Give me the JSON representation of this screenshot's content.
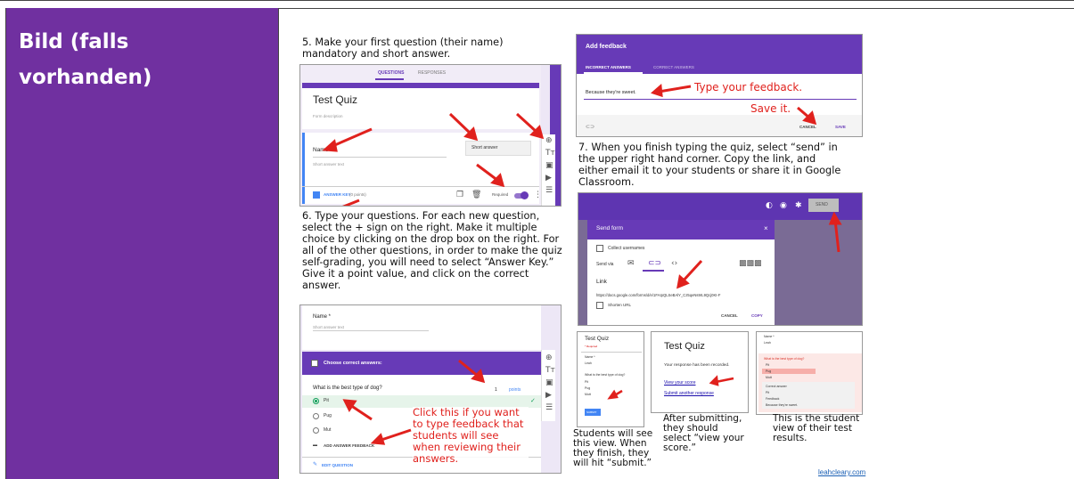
{
  "label": "Bild (falls vorhanden)",
  "captions": {
    "step5": "5. Make your first question (their name) mandatory and short answer.",
    "step6": "6. Type your questions. For each new question, select the + sign on the right. Make it multiple choice by clicking on the drop box on the right. For all of the other questions, in order to make the quiz self-grading, you will need to select “Answer Key.” Give it a point value, and click on the correct answer.",
    "step7": "7. When you finish typing the quiz, select “send” in the upper right hand corner. Copy the link, and either email it to your students or share it in Google Classroom.",
    "students_view": "Students will see this view. When they finish, they will hit “submit.”",
    "after_submit": "After submitting, they should select “view your score.”",
    "student_results": "This is the student view of their test results.",
    "credit": "leahcleary.com"
  },
  "shot1": {
    "tab_questions": "QUESTIONS",
    "tab_responses": "RESPONSES",
    "form_title": "Test Quiz",
    "form_description": "Form description",
    "question_name": "Name",
    "short_answer_text": "Short answer text",
    "question_type": "Short answer",
    "answer_key": "ANSWER KEY",
    "points": "(0 points)",
    "required": "Required"
  },
  "shot2": {
    "question_name": "Name *",
    "short_answer_text": "Short answer text",
    "choose_correct": "Choose correct answers:",
    "question": "What is the best type of dog?",
    "points_value": "1",
    "points_label": "points",
    "options": [
      "Pit",
      "Pug",
      "Mut"
    ],
    "add_feedback": "ADD ANSWER FEEDBACK",
    "edit_question": "EDIT QUESTION",
    "red_note": "Click this if you want to type feedback that students will see when reviewing their answers."
  },
  "shot3": {
    "title": "Add feedback",
    "tab_incorrect": "INCORRECT ANSWERS",
    "tab_correct": "CORRECT ANSWERS",
    "feedback_text": "Because they're sweet.",
    "red_type": "Type your feedback.",
    "red_save": "Save it.",
    "cancel": "CANCEL",
    "save": "SAVE"
  },
  "shot4": {
    "send_button": "SEND",
    "dialog_title": "Send form",
    "collect_usernames": "Collect usernames",
    "send_via": "Send via",
    "link_label": "Link",
    "link_url": "https://docs.google.com/forms/d/e/1FAIpQLSeBAlY_Cz5qeNs9rL9Qcj0KI-F",
    "shorten_url": "Shorten URL",
    "cancel": "CANCEL",
    "copy": "COPY"
  },
  "shot5": {
    "title": "Test Quiz",
    "required_note": "* Required",
    "name_label": "Name *",
    "name_value": "Leah",
    "question": "What is the best type of dog?",
    "options": [
      "Pit",
      "Pug",
      "Mutt"
    ],
    "submit": "SUBMIT"
  },
  "shot6": {
    "title": "Test Quiz",
    "recorded": "Your response has been recorded.",
    "view_score": "View your score",
    "submit_another": "Submit another response"
  },
  "shot7": {
    "name_label": "Name *",
    "name_value": "Leah",
    "question": "What is the best type of dog?",
    "options": [
      "Pit",
      "Pug",
      "Mutt"
    ],
    "correct_answer_label": "Correct answer",
    "correct_answer_value": "Pit",
    "feedback_label": "Feedback",
    "feedback_value": "Because they're sweet."
  },
  "colors": {
    "label_bg": "#7030a0",
    "forms_purple": "#673ab7",
    "arrow_red": "#e0211d"
  }
}
